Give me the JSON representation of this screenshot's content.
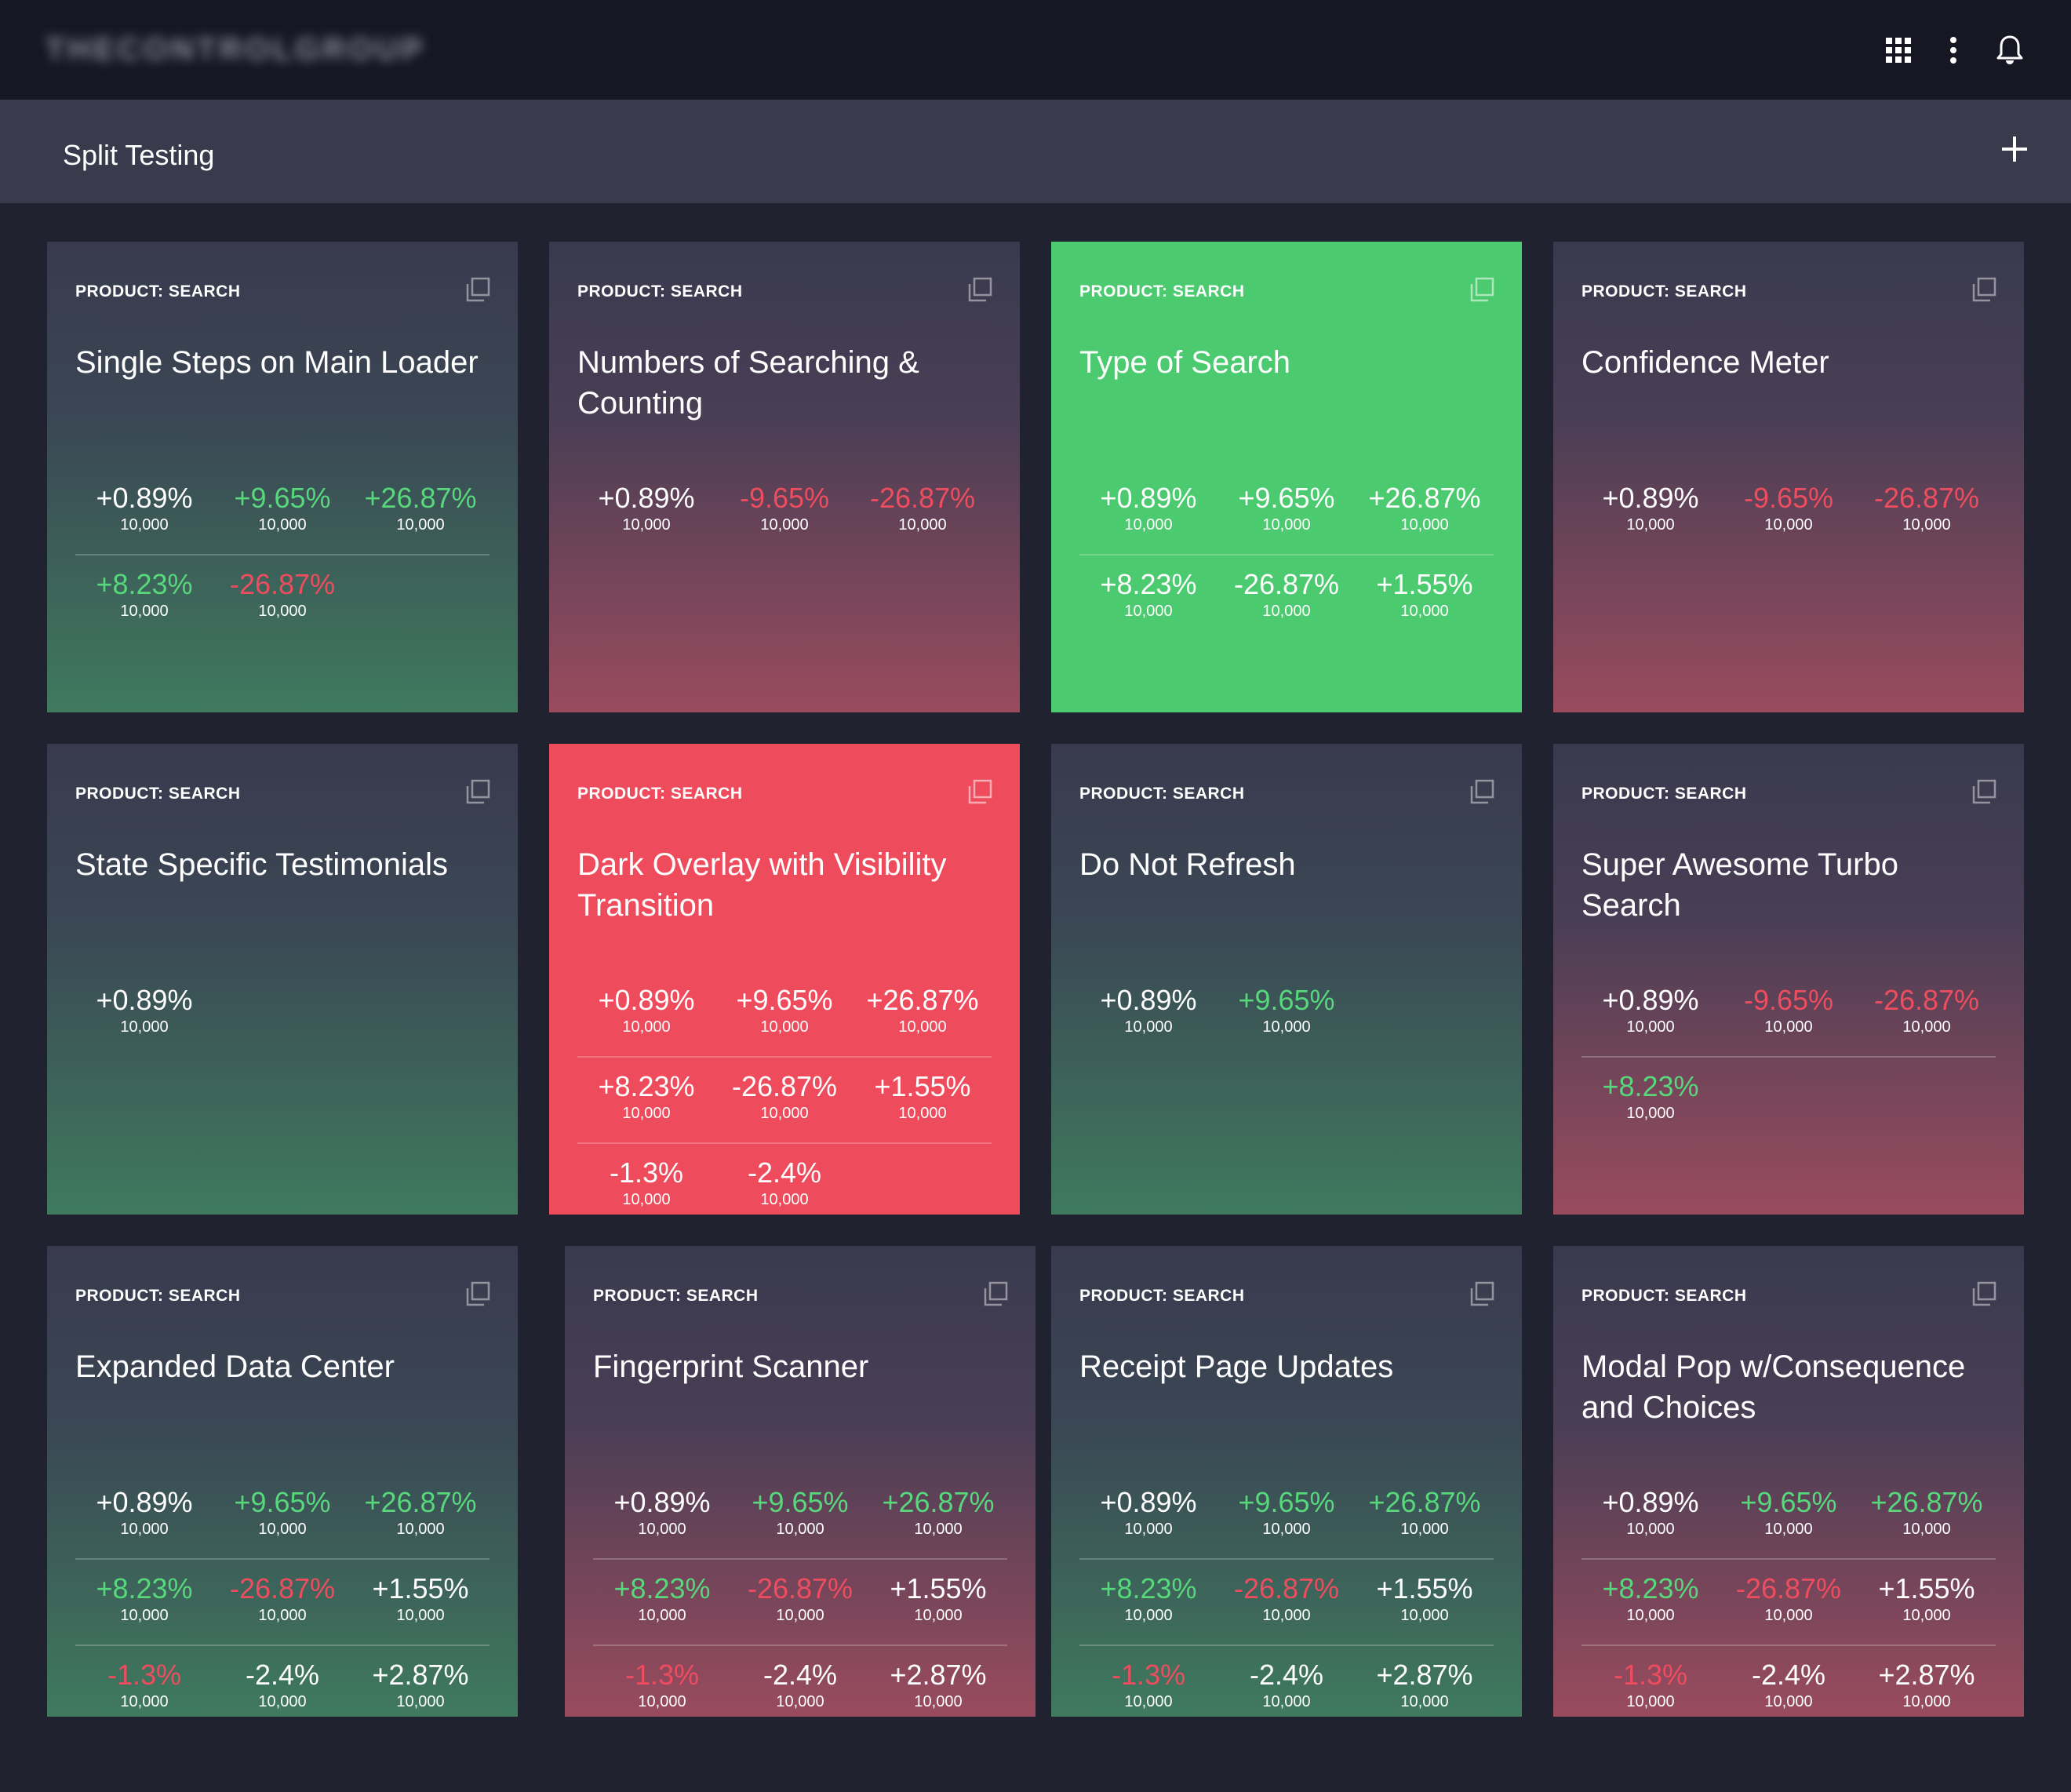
{
  "header": {
    "logo_text": "THECONTROLGROUP",
    "icons": [
      "apps-grid-icon",
      "more-vert-icon",
      "bell-icon"
    ]
  },
  "subheader": {
    "title": "Split Testing",
    "add_icon": "plus-icon"
  },
  "colors": {
    "background": "#21222f",
    "topbar": "#161722",
    "subbar": "#393a4c",
    "positive": "#58d77c",
    "negative": "#ee4d5f",
    "highlight_green": "#4cca6f",
    "highlight_red": "#ee4b5c"
  },
  "cards": [
    {
      "category": "PRODUCT: SEARCH",
      "title": "Single Steps on Main Loader",
      "style": "grad-green",
      "rows": [
        [
          {
            "pct": "+0.89%",
            "tone": "w",
            "count": "10,000"
          },
          {
            "pct": "+9.65%",
            "tone": "g",
            "count": "10,000"
          },
          {
            "pct": "+26.87%",
            "tone": "g",
            "count": "10,000"
          }
        ],
        [
          {
            "pct": "+8.23%",
            "tone": "g",
            "count": "10,000"
          },
          {
            "pct": "-26.87%",
            "tone": "r",
            "count": "10,000"
          }
        ]
      ]
    },
    {
      "category": "PRODUCT: SEARCH",
      "title": "Numbers of Searching & Counting",
      "style": "grad-red",
      "rows": [
        [
          {
            "pct": "+0.89%",
            "tone": "w",
            "count": "10,000"
          },
          {
            "pct": "-9.65%",
            "tone": "r",
            "count": "10,000"
          },
          {
            "pct": "-26.87%",
            "tone": "r",
            "count": "10,000"
          }
        ]
      ]
    },
    {
      "category": "PRODUCT: SEARCH",
      "title": "Type of Search",
      "style": "solid-green",
      "rows": [
        [
          {
            "pct": "+0.89%",
            "tone": "w",
            "count": "10,000"
          },
          {
            "pct": "+9.65%",
            "tone": "w",
            "count": "10,000"
          },
          {
            "pct": "+26.87%",
            "tone": "w",
            "count": "10,000"
          }
        ],
        [
          {
            "pct": "+8.23%",
            "tone": "w",
            "count": "10,000"
          },
          {
            "pct": "-26.87%",
            "tone": "w",
            "count": "10,000"
          },
          {
            "pct": "+1.55%",
            "tone": "w",
            "count": "10,000"
          }
        ]
      ]
    },
    {
      "category": "PRODUCT: SEARCH",
      "title": "Confidence Meter",
      "style": "grad-red",
      "rows": [
        [
          {
            "pct": "+0.89%",
            "tone": "w",
            "count": "10,000"
          },
          {
            "pct": "-9.65%",
            "tone": "r",
            "count": "10,000"
          },
          {
            "pct": "-26.87%",
            "tone": "r",
            "count": "10,000"
          }
        ]
      ]
    },
    {
      "category": "PRODUCT: SEARCH",
      "title": "State Specific Testimonials",
      "style": "grad-green",
      "rows": [
        [
          {
            "pct": "+0.89%",
            "tone": "w",
            "count": "10,000"
          }
        ]
      ]
    },
    {
      "category": "PRODUCT: SEARCH",
      "title": "Dark Overlay with Visibility Transition",
      "style": "solid-red",
      "rows": [
        [
          {
            "pct": "+0.89%",
            "tone": "w",
            "count": "10,000"
          },
          {
            "pct": "+9.65%",
            "tone": "w",
            "count": "10,000"
          },
          {
            "pct": "+26.87%",
            "tone": "w",
            "count": "10,000"
          }
        ],
        [
          {
            "pct": "+8.23%",
            "tone": "w",
            "count": "10,000"
          },
          {
            "pct": "-26.87%",
            "tone": "w",
            "count": "10,000"
          },
          {
            "pct": "+1.55%",
            "tone": "w",
            "count": "10,000"
          }
        ],
        [
          {
            "pct": "-1.3%",
            "tone": "w",
            "count": "10,000"
          },
          {
            "pct": "-2.4%",
            "tone": "w",
            "count": "10,000"
          }
        ]
      ]
    },
    {
      "category": "PRODUCT: SEARCH",
      "title": "Do Not Refresh",
      "style": "grad-green",
      "rows": [
        [
          {
            "pct": "+0.89%",
            "tone": "w",
            "count": "10,000"
          },
          {
            "pct": "+9.65%",
            "tone": "g",
            "count": "10,000"
          }
        ]
      ]
    },
    {
      "category": "PRODUCT: SEARCH",
      "title": "Super Awesome Turbo Search",
      "style": "grad-red",
      "rows": [
        [
          {
            "pct": "+0.89%",
            "tone": "w",
            "count": "10,000"
          },
          {
            "pct": "-9.65%",
            "tone": "r",
            "count": "10,000"
          },
          {
            "pct": "-26.87%",
            "tone": "r",
            "count": "10,000"
          }
        ],
        [
          {
            "pct": "+8.23%",
            "tone": "g",
            "count": "10,000"
          }
        ]
      ]
    },
    {
      "category": "PRODUCT: SEARCH",
      "title": "Expanded Data Center",
      "style": "grad-green",
      "rows": [
        [
          {
            "pct": "+0.89%",
            "tone": "w",
            "count": "10,000"
          },
          {
            "pct": "+9.65%",
            "tone": "g",
            "count": "10,000"
          },
          {
            "pct": "+26.87%",
            "tone": "g",
            "count": "10,000"
          }
        ],
        [
          {
            "pct": "+8.23%",
            "tone": "g",
            "count": "10,000"
          },
          {
            "pct": "-26.87%",
            "tone": "r",
            "count": "10,000"
          },
          {
            "pct": "+1.55%",
            "tone": "w",
            "count": "10,000"
          }
        ],
        [
          {
            "pct": "-1.3%",
            "tone": "r",
            "count": "10,000"
          },
          {
            "pct": "-2.4%",
            "tone": "w",
            "count": "10,000"
          },
          {
            "pct": "+2.87%",
            "tone": "w",
            "count": "10,000"
          }
        ]
      ]
    },
    {
      "category": "PRODUCT: SEARCH",
      "title": "Fingerprint Scanner",
      "style": "grad-red",
      "rows": [
        [
          {
            "pct": "+0.89%",
            "tone": "w",
            "count": "10,000"
          },
          {
            "pct": "+9.65%",
            "tone": "g",
            "count": "10,000"
          },
          {
            "pct": "+26.87%",
            "tone": "g",
            "count": "10,000"
          }
        ],
        [
          {
            "pct": "+8.23%",
            "tone": "g",
            "count": "10,000"
          },
          {
            "pct": "-26.87%",
            "tone": "r",
            "count": "10,000"
          },
          {
            "pct": "+1.55%",
            "tone": "w",
            "count": "10,000"
          }
        ],
        [
          {
            "pct": "-1.3%",
            "tone": "r",
            "count": "10,000"
          },
          {
            "pct": "-2.4%",
            "tone": "w",
            "count": "10,000"
          },
          {
            "pct": "+2.87%",
            "tone": "w",
            "count": "10,000"
          }
        ]
      ]
    },
    {
      "category": "PRODUCT: SEARCH",
      "title": "Receipt Page Updates",
      "style": "grad-green",
      "rows": [
        [
          {
            "pct": "+0.89%",
            "tone": "w",
            "count": "10,000"
          },
          {
            "pct": "+9.65%",
            "tone": "g",
            "count": "10,000"
          },
          {
            "pct": "+26.87%",
            "tone": "g",
            "count": "10,000"
          }
        ],
        [
          {
            "pct": "+8.23%",
            "tone": "g",
            "count": "10,000"
          },
          {
            "pct": "-26.87%",
            "tone": "r",
            "count": "10,000"
          },
          {
            "pct": "+1.55%",
            "tone": "w",
            "count": "10,000"
          }
        ],
        [
          {
            "pct": "-1.3%",
            "tone": "r",
            "count": "10,000"
          },
          {
            "pct": "-2.4%",
            "tone": "w",
            "count": "10,000"
          },
          {
            "pct": "+2.87%",
            "tone": "w",
            "count": "10,000"
          }
        ]
      ]
    },
    {
      "category": "PRODUCT: SEARCH",
      "title": "Modal Pop w/Consequence and Choices",
      "style": "grad-red",
      "rows": [
        [
          {
            "pct": "+0.89%",
            "tone": "w",
            "count": "10,000"
          },
          {
            "pct": "+9.65%",
            "tone": "g",
            "count": "10,000"
          },
          {
            "pct": "+26.87%",
            "tone": "g",
            "count": "10,000"
          }
        ],
        [
          {
            "pct": "+8.23%",
            "tone": "g",
            "count": "10,000"
          },
          {
            "pct": "-26.87%",
            "tone": "r",
            "count": "10,000"
          },
          {
            "pct": "+1.55%",
            "tone": "w",
            "count": "10,000"
          }
        ],
        [
          {
            "pct": "-1.3%",
            "tone": "r",
            "count": "10,000"
          },
          {
            "pct": "-2.4%",
            "tone": "w",
            "count": "10,000"
          },
          {
            "pct": "+2.87%",
            "tone": "w",
            "count": "10,000"
          }
        ]
      ]
    }
  ]
}
